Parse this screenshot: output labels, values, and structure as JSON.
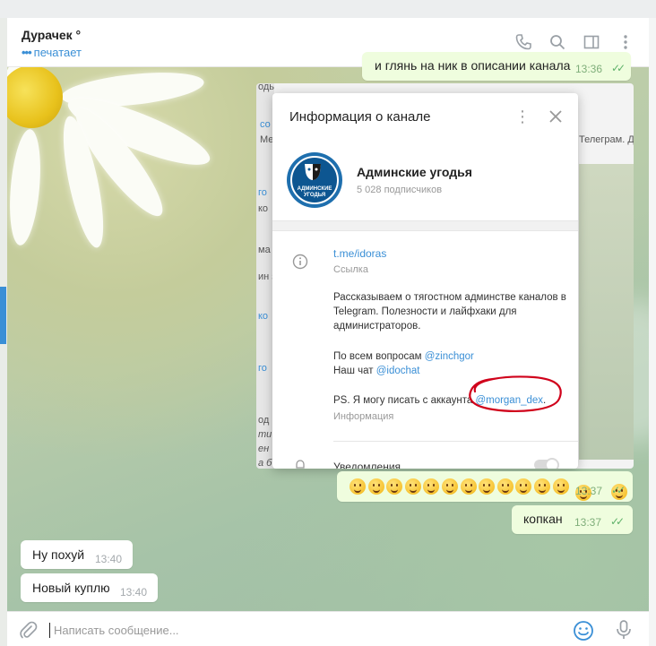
{
  "header": {
    "title": "Дурачек °",
    "status": "печатает"
  },
  "messages": {
    "top_partial": {
      "text": "и глянь на ник в описании канала",
      "time": "13:36"
    },
    "emoji": {
      "time": "13:37",
      "count": 12
    },
    "kopkan": {
      "text": "копкан",
      "time": "13:37"
    },
    "nu": {
      "text": "Ну похуй",
      "time": "13:40"
    },
    "new": {
      "text": "Новый куплю",
      "time": "13:40"
    }
  },
  "screenshot_fragments": {
    "f1": "одь",
    "f2": "со",
    "f3": "Ме",
    "f4": "Телеграм. Д",
    "f5": "го",
    "f6": "ко",
    "f7": "ма",
    "f8": "ин за",
    "f9": "ко",
    "f10": "го",
    "f11": "од",
    "f12": "ти",
    "f13": "ен",
    "f14": "а б"
  },
  "dialog": {
    "title": "Информация о канале",
    "channel_name": "Админские угодья",
    "avatar_caption_1": "АДМИНСКИЕ",
    "avatar_caption_2": "УГОДЬЯ",
    "subscribers": "5 028 подписчиков",
    "link": "t.me/idoras",
    "link_label": "Ссылка",
    "desc_1": "Рассказываем о тягостном админстве каналов в Telegram. Полезности и лайфхаки для администраторов.",
    "desc_2_prefix": "По всем вопросам",
    "desc_2_link": "@zinchgor",
    "desc_3_prefix": "Наш чат",
    "desc_3_link": "@idochat",
    "desc_4_prefix": "PS. Я могу писать с аккаунта",
    "desc_4_link": "@morgan_dex",
    "desc_4_suffix": ".",
    "info_label": "Информация",
    "notifications": "Уведомления"
  },
  "input": {
    "placeholder": "Написать сообщение..."
  },
  "colors": {
    "accent": "#3a8fd6",
    "out_bubble": "#effdde",
    "circle": "#d0021b"
  }
}
